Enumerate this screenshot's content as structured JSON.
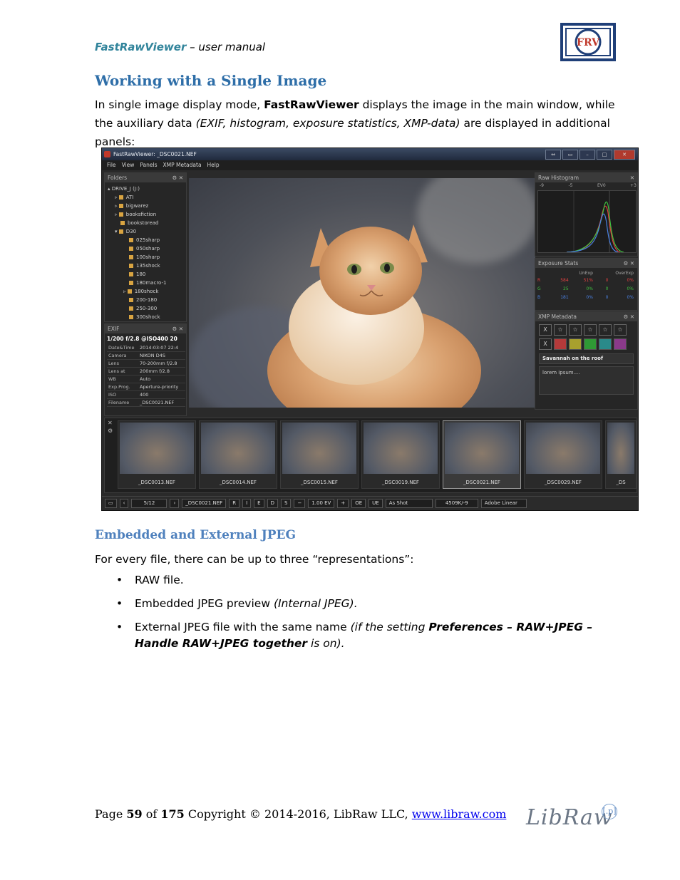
{
  "header": {
    "brand": "FastRawViewer",
    "subtitle": " – user manual",
    "logo_text": "FRV"
  },
  "section": {
    "title": "Working with a Single Image",
    "intro_part1": "In single image display mode, ",
    "intro_bold": "FastRawViewer",
    "intro_part2": " displays the image in the main window, while the auxiliary data ",
    "intro_italic": "(EXIF, histogram, exposure statistics, XMP-data)",
    "intro_part3": " are displayed in additional panels:"
  },
  "screenshot": {
    "window_title": "FastRawViewer: _DSC0021.NEF",
    "menu": [
      "File",
      "View",
      "Panels",
      "XMP Metadata",
      "Help"
    ],
    "folders_panel": {
      "title": "Folders",
      "items": [
        "DRIVE_J (J:)",
        "ATI",
        "bigwarez",
        "booksfiction",
        "bookstoread",
        "D30",
        "025sharp",
        "050sharp",
        "100sharp",
        "135shock",
        "180",
        "180macro-1",
        "180shock",
        "200-180",
        "250-300",
        "300shock"
      ]
    },
    "exif_panel": {
      "title": "EXIF",
      "summary": "1/200 f/2.8 @ISO400 20",
      "rows": [
        {
          "k": "Date&Time",
          "v": "2014:03:07 22:4"
        },
        {
          "k": "Camera",
          "v": "NIKON D4S"
        },
        {
          "k": "Lens",
          "v": "70-200mm f/2.8"
        },
        {
          "k": "Lens at",
          "v": "200mm f/2.8"
        },
        {
          "k": "WB",
          "v": "Auto"
        },
        {
          "k": "Exp.Prog.",
          "v": "Aperture-priority"
        },
        {
          "k": "ISO",
          "v": "400"
        },
        {
          "k": "Filename",
          "v": "_DSC0021.NEF"
        }
      ]
    },
    "histogram_panel": {
      "title": "Raw Histogram",
      "scale": [
        "-9",
        "-5",
        "EV0",
        "+3"
      ]
    },
    "exposure_panel": {
      "title": "Exposure Stats",
      "headers": [
        "UnExp",
        "OverExp"
      ],
      "rows": [
        {
          "ch": "R",
          "a": "584",
          "b": "51%",
          "c": "0",
          "d": "0%",
          "color": "#e04040"
        },
        {
          "ch": "G",
          "a": "25",
          "b": "0%",
          "c": "0",
          "d": "0%",
          "color": "#40c040"
        },
        {
          "ch": "B",
          "a": "181",
          "b": "0%",
          "c": "0",
          "d": "0%",
          "color": "#4a80e0"
        }
      ]
    },
    "xmp_panel": {
      "title": "XMP Metadata",
      "reject": "X",
      "star": "☆",
      "label_colors": [
        "#b53a3a",
        "#a8a02e",
        "#2f9a35",
        "#2a8a8a",
        "#8a3a8a"
      ],
      "title_value": "Savannah on the roof",
      "description_value": "lorem ipsum...."
    },
    "filmstrip": [
      "_DSC0013.NEF",
      "_DSC0014.NEF",
      "_DSC0015.NEF",
      "_DSC0019.NEF",
      "_DSC0021.NEF",
      "_DSC0029.NEF",
      "_DS"
    ],
    "statusbar": {
      "counter": "5/12",
      "filename": "_DSC0021.NEF",
      "modes": [
        "R",
        "I",
        "E",
        "D",
        "S"
      ],
      "ev": "1.00 EV",
      "oe": "OE",
      "ue": "UE",
      "wb": "As Shot",
      "temp": "4509K/-9",
      "profile": "Adobe Linear"
    }
  },
  "subsection": {
    "title": "Embedded and External JPEG",
    "intro": "For every file, there can be up to three “representations”:",
    "bullet1": "RAW file.",
    "bullet2_text": "Embedded JPEG preview ",
    "bullet2_italic": "(Internal JPEG).",
    "bullet3_text": "External JPEG file with the same name ",
    "bullet3_italic1": "(if the setting ",
    "bullet3_bold": "Preferences – RAW+JPEG – Handle RAW+JPEG together",
    "bullet3_italic2": " is on)."
  },
  "footer": {
    "page_prefix": "Page ",
    "page_num": "59",
    "of": " of ",
    "page_total": "175",
    "copyright": " Copyright © 2014-2016, LibRaw LLC, ",
    "link": "www.libraw.com",
    "logo_word": "LibRaw",
    "logo_badge": "[.p]"
  }
}
